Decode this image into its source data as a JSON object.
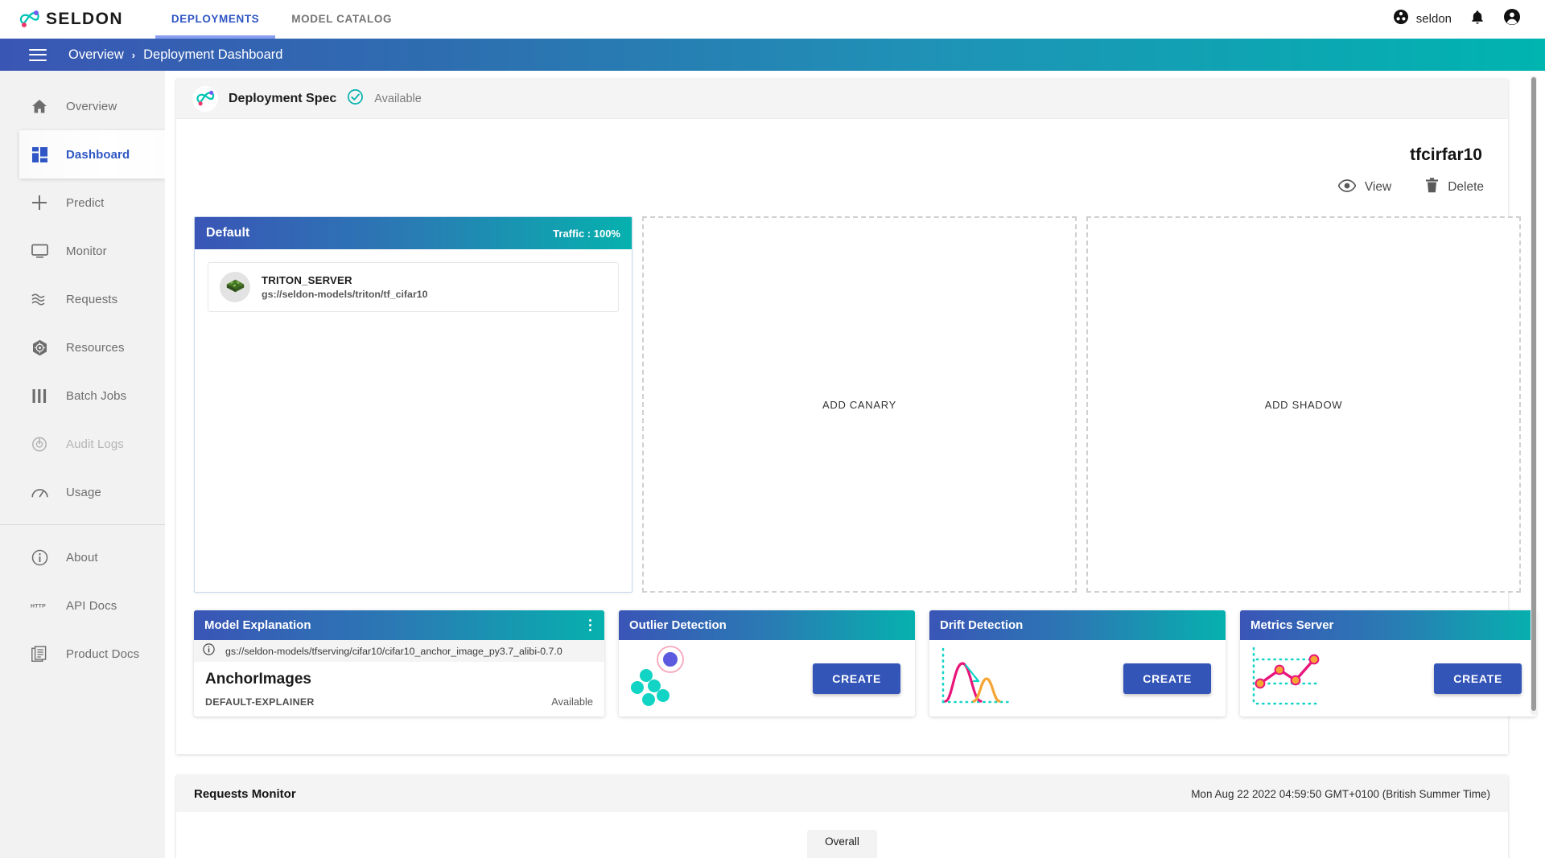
{
  "topnav": {
    "brand": "SELDON",
    "brand_logo_icon": "seldon-logo-icon",
    "tabs": [
      {
        "label": "DEPLOYMENTS",
        "active": true
      },
      {
        "label": "MODEL CATALOG",
        "active": false
      }
    ],
    "user": "seldon",
    "user_org_icon": "org-icon",
    "notification_icon": "bell-icon",
    "account_icon": "account-circle-icon"
  },
  "breadcrumb": {
    "menu_icon": "hamburger-menu-icon",
    "items": [
      "Overview",
      "Deployment Dashboard"
    ],
    "separator": "›"
  },
  "sidebar": {
    "items": [
      {
        "label": "Overview",
        "icon": "home-icon",
        "active": false,
        "disabled": false
      },
      {
        "label": "Dashboard",
        "icon": "dashboard-icon",
        "active": true,
        "disabled": false
      },
      {
        "label": "Predict",
        "icon": "plus-icon",
        "active": false,
        "disabled": false
      },
      {
        "label": "Monitor",
        "icon": "monitor-icon",
        "active": false,
        "disabled": false
      },
      {
        "label": "Requests",
        "icon": "waves-icon",
        "active": false,
        "disabled": false
      },
      {
        "label": "Resources",
        "icon": "kubernetes-icon",
        "active": false,
        "disabled": false
      },
      {
        "label": "Batch Jobs",
        "icon": "bars-icon",
        "active": false,
        "disabled": false
      },
      {
        "label": "Audit Logs",
        "icon": "audit-icon",
        "active": false,
        "disabled": true
      },
      {
        "label": "Usage",
        "icon": "gauge-icon",
        "active": false,
        "disabled": false
      }
    ],
    "footer_items": [
      {
        "label": "About",
        "icon": "info-circle-icon"
      },
      {
        "label": "API Docs",
        "icon": "http-icon"
      },
      {
        "label": "Product Docs",
        "icon": "document-stack-icon"
      }
    ]
  },
  "spec": {
    "logo_icon": "seldon-mark-icon",
    "title": "Deployment Spec",
    "status_icon": "check-circle-icon",
    "status": "Available"
  },
  "deployment": {
    "name": "tfcirfar10",
    "actions": [
      {
        "label": "View",
        "icon": "eye-icon"
      },
      {
        "label": "Delete",
        "icon": "trash-icon"
      }
    ]
  },
  "predictor": {
    "title": "Default",
    "traffic": "Traffic : 100%",
    "model": {
      "avatar_icon": "triton-server-icon",
      "name": "TRITON_SERVER",
      "uri": "gs://seldon-models/triton/tf_cifar10"
    }
  },
  "slots": [
    {
      "label": "ADD CANARY",
      "name": "add-canary-slot"
    },
    {
      "label": "ADD SHADOW",
      "name": "add-shadow-slot"
    }
  ],
  "components": {
    "explanation": {
      "title": "Model Explanation",
      "menu_icon": "kebab-menu-icon",
      "info_icon": "info-circle-icon",
      "uri": "gs://seldon-models/tfserving/cifar10/cifar10_anchor_image_py3.7_alibi-0.7.0",
      "name": "AnchorImages",
      "type": "DEFAULT-EXPLAINER",
      "status": "Available"
    },
    "outlier": {
      "title": "Outlier Detection",
      "illustration_icon": "outlier-scatter-icon",
      "create_label": "CREATE"
    },
    "drift": {
      "title": "Drift Detection",
      "illustration_icon": "drift-curves-icon",
      "create_label": "CREATE"
    },
    "metrics": {
      "title": "Metrics Server",
      "illustration_icon": "metrics-line-icon",
      "create_label": "CREATE"
    }
  },
  "requests_monitor": {
    "title": "Requests Monitor",
    "timestamp": "Mon Aug 22 2022 04:59:50 GMT+0100 (British Summer Time)",
    "tab": "Overall"
  },
  "colors": {
    "accent_blue": "#2f56c4",
    "gradient_start": "#3a55b6",
    "gradient_end": "#06b1ae",
    "create_button": "#3355b8",
    "teal": "#00b4b0"
  }
}
